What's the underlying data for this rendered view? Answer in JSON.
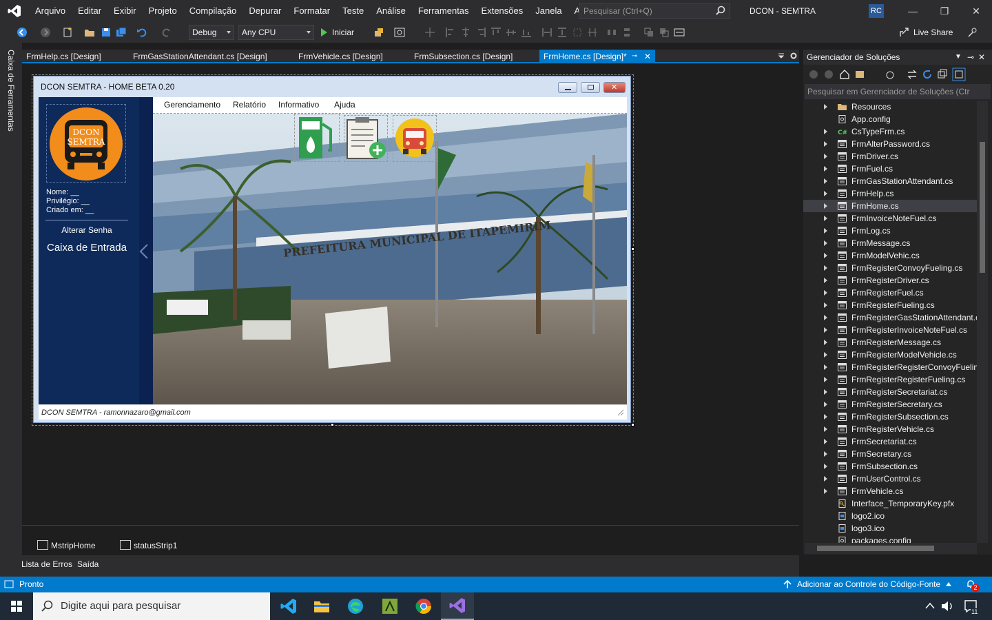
{
  "menubar": {
    "items": [
      "Arquivo",
      "Editar",
      "Exibir",
      "Projeto",
      "Compilação",
      "Depurar",
      "Formatar",
      "Teste",
      "Análise",
      "Ferramentas",
      "Extensões",
      "Janela",
      "Ajuda"
    ],
    "search_placeholder": "Pesquisar (Ctrl+Q)",
    "solution_title": "DCON - SEMTRA",
    "user_initials": "RC"
  },
  "toolbar": {
    "config": "Debug",
    "platform": "Any CPU",
    "start_label": "Iniciar",
    "live_share": "Live Share"
  },
  "left_strip": {
    "toolbox_label": "Caixa de Ferramentas"
  },
  "tabs": [
    {
      "label": "FrmHelp.cs [Design]"
    },
    {
      "label": "FrmGasStationAttendant.cs [Design]"
    },
    {
      "label": "FrmVehicle.cs [Design]"
    },
    {
      "label": "FrmSubsection.cs [Design]"
    },
    {
      "label": "FrmHome.cs [Design]*"
    }
  ],
  "form": {
    "title": "DCON SEMTRA - HOME BETA 0.20",
    "logo_text_line1": "DCON",
    "logo_text_line2": "SEMTRA",
    "nome_label": "Nome:  __",
    "privilegio_label": "Privilégio:  __",
    "criado_label": "Criado em: __",
    "alter_password": "Alterar Senha",
    "inbox": "Caixa de Entrada",
    "menu": [
      "Gerenciamento",
      "Relatório",
      "Informativo",
      "Ajuda"
    ],
    "building_sign": "PREFEITURA MUNICIPAL DE ITAPEMIRIM",
    "status_text": "DCON SEMTRA - ramonnazaro@gmail.com"
  },
  "component_tray": {
    "items": [
      "MstripHome",
      "statusStrip1"
    ]
  },
  "bottom_tabs": [
    "Lista de Erros",
    "Saída"
  ],
  "solution_explorer": {
    "title": "Gerenciador de Soluções",
    "search_placeholder": "Pesquisar em Gerenciador de Soluções (Ctr",
    "items": [
      {
        "label": "Resources",
        "icon": "folder-icon",
        "expandable": true
      },
      {
        "label": "App.config",
        "icon": "config-icon",
        "expandable": false
      },
      {
        "label": "CsTypeFrm.cs",
        "icon": "csharp-icon",
        "expandable": true
      },
      {
        "label": "FrmAlterPassword.cs",
        "icon": "form-icon",
        "expandable": true
      },
      {
        "label": "FrmDriver.cs",
        "icon": "form-icon",
        "expandable": true
      },
      {
        "label": "FrmFuel.cs",
        "icon": "form-icon",
        "expandable": true
      },
      {
        "label": "FrmGasStationAttendant.cs",
        "icon": "form-icon",
        "expandable": true
      },
      {
        "label": "FrmHelp.cs",
        "icon": "form-icon",
        "expandable": true
      },
      {
        "label": "FrmHome.cs",
        "icon": "form-icon",
        "expandable": true,
        "selected": true
      },
      {
        "label": "FrmInvoiceNoteFuel.cs",
        "icon": "form-icon",
        "expandable": true
      },
      {
        "label": "FrmLog.cs",
        "icon": "form-icon",
        "expandable": true
      },
      {
        "label": "FrmMessage.cs",
        "icon": "form-icon",
        "expandable": true
      },
      {
        "label": "FrmModelVehic.cs",
        "icon": "form-icon",
        "expandable": true
      },
      {
        "label": "FrmRegisterConvoyFueling.cs",
        "icon": "form-icon",
        "expandable": true
      },
      {
        "label": "FrmRegisterDriver.cs",
        "icon": "form-icon",
        "expandable": true
      },
      {
        "label": "FrmRegisterFuel.cs",
        "icon": "form-icon",
        "expandable": true
      },
      {
        "label": "FrmRegisterFueling.cs",
        "icon": "form-icon",
        "expandable": true
      },
      {
        "label": "FrmRegisterGasStationAttendant.c",
        "icon": "form-icon",
        "expandable": true
      },
      {
        "label": "FrmRegisterInvoiceNoteFuel.cs",
        "icon": "form-icon",
        "expandable": true
      },
      {
        "label": "FrmRegisterMessage.cs",
        "icon": "form-icon",
        "expandable": true
      },
      {
        "label": "FrmRegisterModelVehicle.cs",
        "icon": "form-icon",
        "expandable": true
      },
      {
        "label": "FrmRegisterRegisterConvoyFuelin",
        "icon": "form-icon",
        "expandable": true
      },
      {
        "label": "FrmRegisterRegisterFueling.cs",
        "icon": "form-icon",
        "expandable": true
      },
      {
        "label": "FrmRegisterSecretariat.cs",
        "icon": "form-icon",
        "expandable": true
      },
      {
        "label": "FrmRegisterSecretary.cs",
        "icon": "form-icon",
        "expandable": true
      },
      {
        "label": "FrmRegisterSubsection.cs",
        "icon": "form-icon",
        "expandable": true
      },
      {
        "label": "FrmRegisterVehicle.cs",
        "icon": "form-icon",
        "expandable": true
      },
      {
        "label": "FrmSecretariat.cs",
        "icon": "form-icon",
        "expandable": true
      },
      {
        "label": "FrmSecretary.cs",
        "icon": "form-icon",
        "expandable": true
      },
      {
        "label": "FrmSubsection.cs",
        "icon": "form-icon",
        "expandable": true
      },
      {
        "label": "FrmUserControl.cs",
        "icon": "form-icon",
        "expandable": true
      },
      {
        "label": "FrmVehicle.cs",
        "icon": "form-icon",
        "expandable": true
      },
      {
        "label": "Interface_TemporaryKey.pfx",
        "icon": "key-file-icon",
        "expandable": false
      },
      {
        "label": "logo2.ico",
        "icon": "ico-file-icon",
        "expandable": false
      },
      {
        "label": "logo3.ico",
        "icon": "ico-file-icon",
        "expandable": false
      },
      {
        "label": "packages.config",
        "icon": "config-icon",
        "expandable": false
      }
    ]
  },
  "statusbar": {
    "status": "Pronto",
    "source_control": "Adicionar ao Controle do Código-Fonte",
    "notifications": "2"
  },
  "taskbar": {
    "search_placeholder": "Digite aqui para pesquisar",
    "notification_count": "11"
  },
  "colors": {
    "accent": "#007acc",
    "ide_bg": "#1e1e1e",
    "panel_bg": "#2d2d30",
    "form_side_panel": "#0e2a5a"
  }
}
